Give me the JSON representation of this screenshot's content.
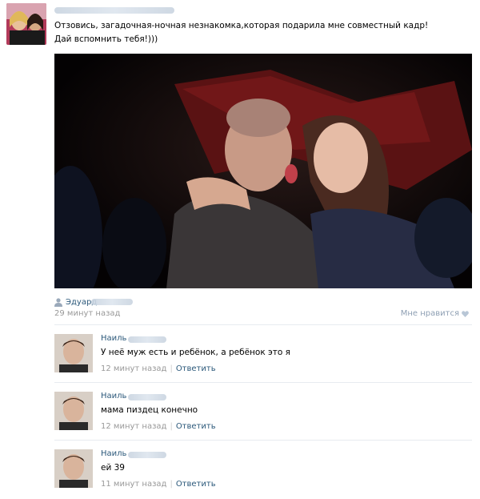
{
  "post": {
    "text_line1": "Отзовись, загадочная-ночная незнакомка,которая подарила мне совместный кадр!",
    "text_line2": "Дай вспомнить тебя!)))",
    "author_name": "Эдуард",
    "time": "29 минут назад",
    "like_label": "Мне нравится",
    "icons": {
      "author": "person-icon",
      "like": "heart-icon"
    }
  },
  "comments": [
    {
      "name": "Наиль",
      "text": "У неё муж есть и ребёнок, а ребёнок это я",
      "time": "12 минут назад",
      "sep": "|",
      "reply": "Ответить"
    },
    {
      "name": "Наиль",
      "text": "мама пиздец конечно",
      "time": "12 минут назад",
      "sep": "|",
      "reply": "Ответить"
    },
    {
      "name": "Наиль",
      "text": "ей 39",
      "time": "11 минут назад",
      "sep": "|",
      "reply": "Ответить"
    }
  ],
  "colors": {
    "link": "#2b587a",
    "meta": "#999999",
    "divider": "#e7ebf0",
    "like": "#8e9fb3"
  }
}
